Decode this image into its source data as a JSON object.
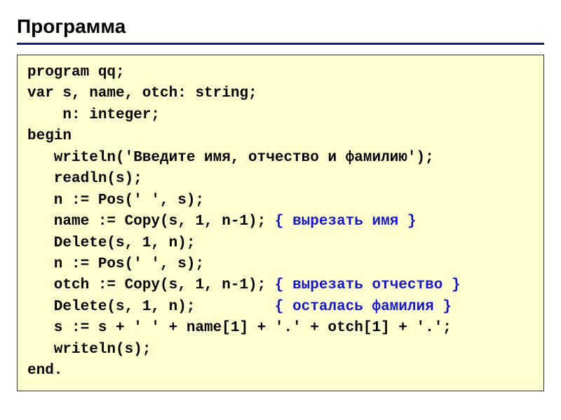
{
  "title": "Программа",
  "code": {
    "l1": "program qq;",
    "l2": "var s, name, otch: string;",
    "l3": "    n: integer;",
    "l4": "begin",
    "l5": "   writeln('Введите имя, отчество и фамилию');",
    "l6": "   readln(s);",
    "l7": "   n := Pos(' ', s);",
    "l8a": "   name := Copy(s, 1, n-1); ",
    "l8c": "{ вырезать имя }",
    "l9": "   Delete(s, 1, n);",
    "l10": "   n := Pos(' ', s);",
    "l11a": "   otch := Copy(s, 1, n-1); ",
    "l11c": "{ вырезать отчество }",
    "l12a": "   Delete(s, 1, n);         ",
    "l12c": "{ осталась фамилия }",
    "l13": "   s := s + ' ' + name[1] + '.' + otch[1] + '.';",
    "l14": "   writeln(s);",
    "l15": "end."
  }
}
